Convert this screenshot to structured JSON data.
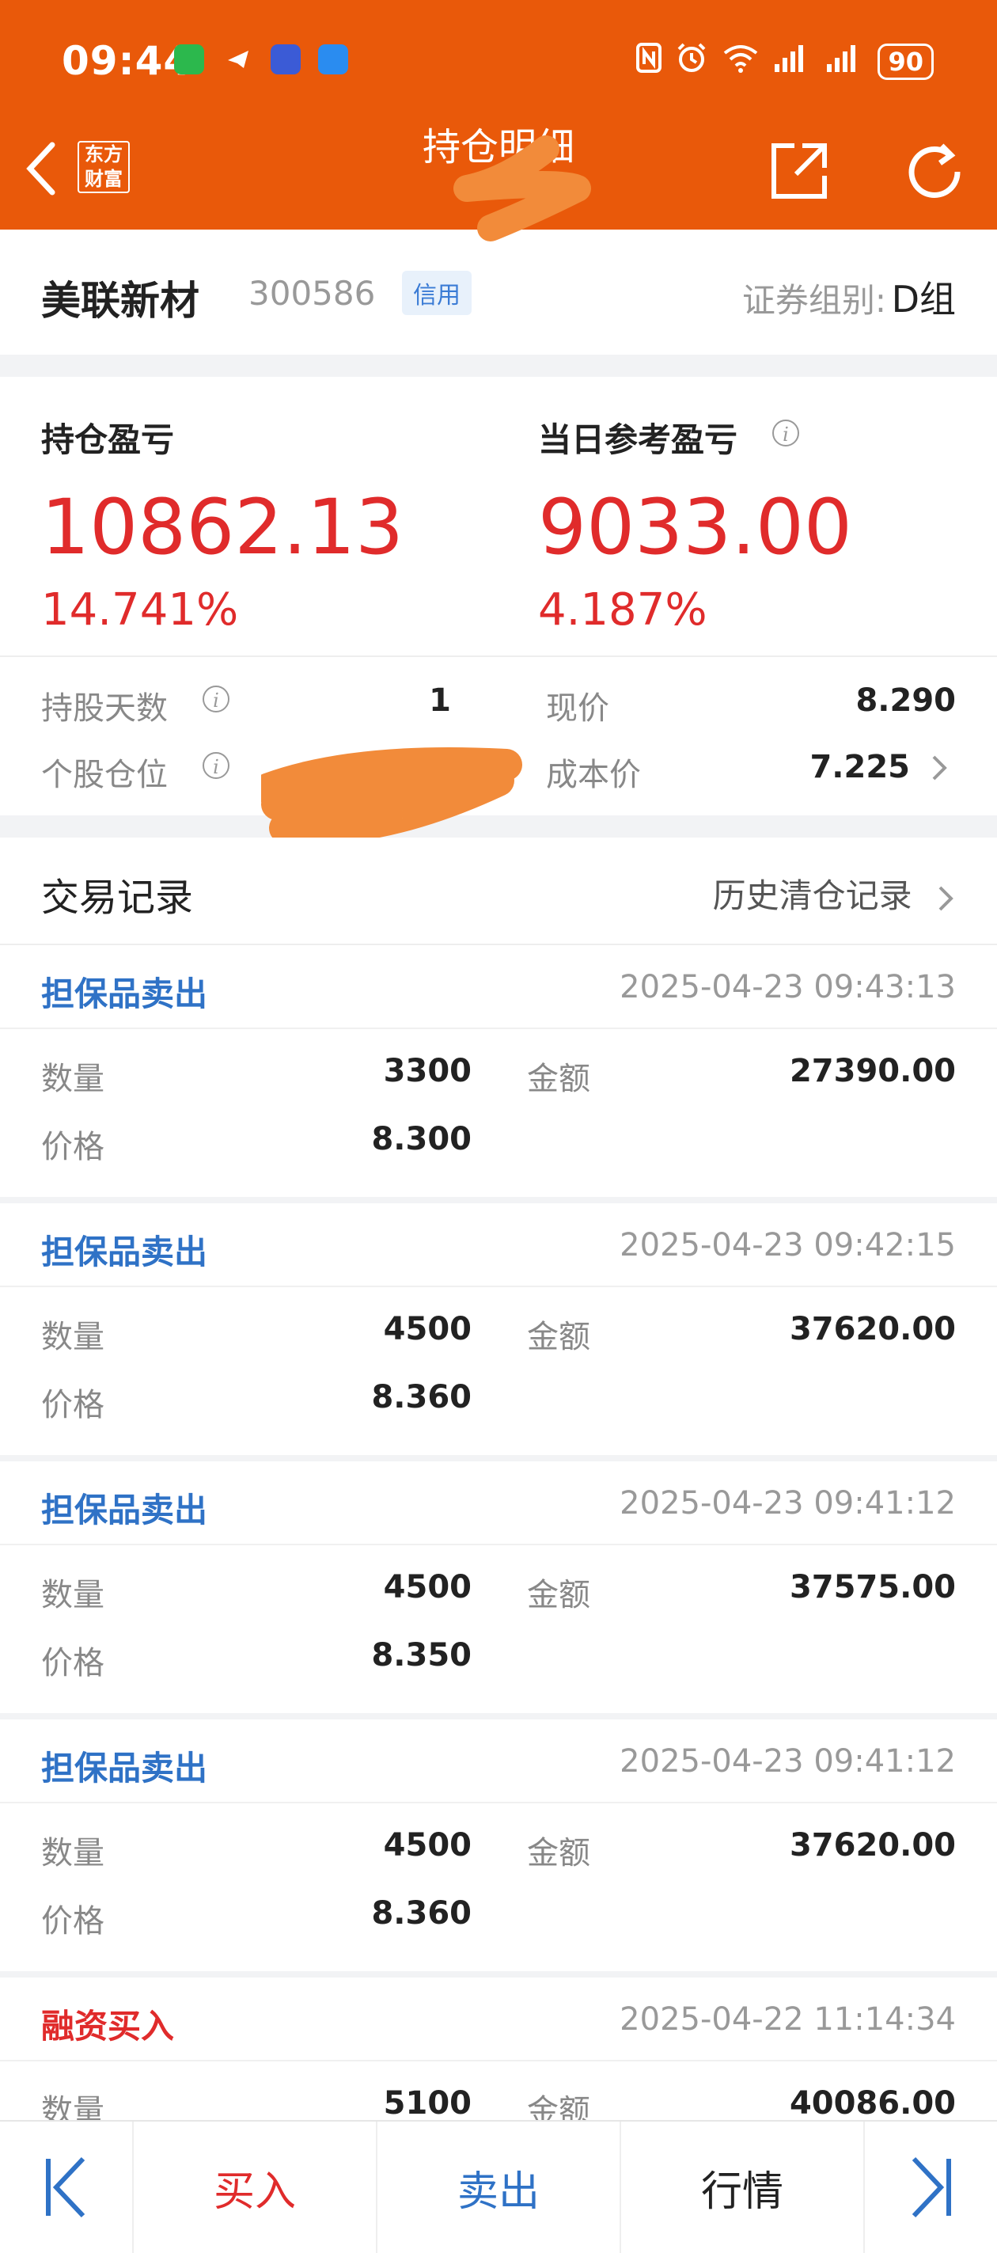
{
  "status_bar": {
    "time": "09:44",
    "battery": "90",
    "signal_label": "6"
  },
  "header": {
    "title": "持仓明细",
    "logo_line1": "东方",
    "logo_line2": "财富"
  },
  "stock": {
    "name": "美联新材",
    "code": "300586",
    "badge": "信用",
    "group_label": "证券组别:",
    "group_value": "D组"
  },
  "pnl": {
    "position_label": "持仓盈亏",
    "position_value": "10862.13",
    "position_pct": "14.741%",
    "daily_label": "当日参考盈亏",
    "daily_value": "9033.00",
    "daily_pct": "4.187%",
    "hold_days_label": "持股天数",
    "hold_days_value": "1",
    "position_ratio_label": "个股仓位",
    "price_label": "现价",
    "price_value": "8.290",
    "cost_label": "成本价",
    "cost_value": "7.225"
  },
  "records": {
    "title": "交易记录",
    "history_link": "历史清仓记录",
    "qty_label": "数量",
    "amount_label": "金额",
    "price_label": "价格",
    "items": [
      {
        "type": "担保品卖出",
        "time": "2025-04-23 09:43:13",
        "qty": "3300",
        "amount": "27390.00",
        "price": "8.300"
      },
      {
        "type": "担保品卖出",
        "time": "2025-04-23 09:42:15",
        "qty": "4500",
        "amount": "37620.00",
        "price": "8.360"
      },
      {
        "type": "担保品卖出",
        "time": "2025-04-23 09:41:12",
        "qty": "4500",
        "amount": "37575.00",
        "price": "8.350"
      },
      {
        "type": "担保品卖出",
        "time": "2025-04-23 09:41:12",
        "qty": "4500",
        "amount": "37620.00",
        "price": "8.360"
      },
      {
        "type": "融资买入",
        "time": "2025-04-22 11:14:34",
        "qty": "5100",
        "amount": "40086.00",
        "price": ""
      }
    ]
  },
  "bottom_bar": {
    "buy": "买入",
    "sell": "卖出",
    "quote": "行情"
  },
  "colors": {
    "brand": "#e9590a",
    "profit_red": "#e02b2b",
    "link_blue": "#2f72c6",
    "redaction": "#f28b3a"
  }
}
